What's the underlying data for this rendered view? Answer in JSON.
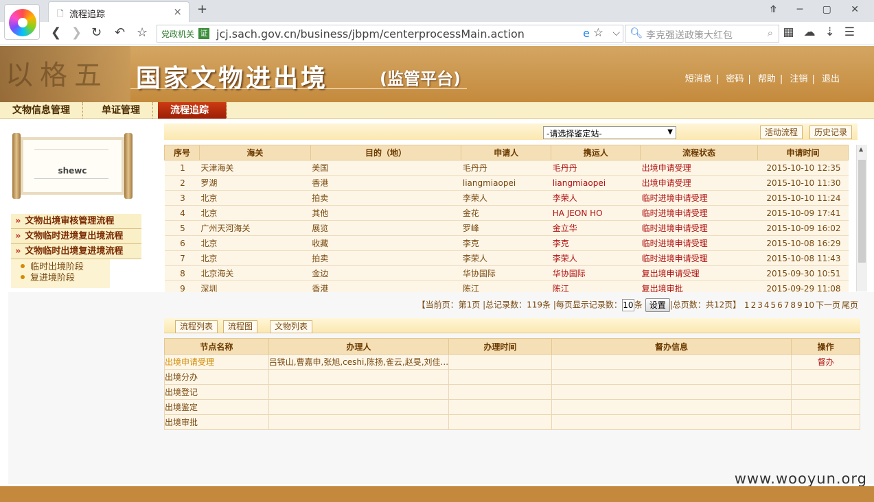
{
  "browser": {
    "tab_title": "流程追踪",
    "new_tab": "+",
    "window_controls": "⤊ ─ ▢ ✕",
    "badge": "党政机关",
    "zheng": "证",
    "url": "jcj.sach.gov.cn/business/jbpm/centerprocessMain.action",
    "search_text": "李克强送政策大红包"
  },
  "site": {
    "glyphs": "以格五",
    "title": "国家文物进出境",
    "subtitle": "(监管平台)",
    "links": [
      "短消息",
      "密码",
      "帮助",
      "注销",
      "退出"
    ]
  },
  "menu": [
    "文物信息管理",
    "单证管理",
    "流程追踪"
  ],
  "user": {
    "name": "shewc"
  },
  "left_menu": [
    "文物出境审核管理流程",
    "文物临时进境复出境流程",
    "文物临时出境复进境流程"
  ],
  "left_submenu": [
    "临时出境阶段",
    "复进境阶段"
  ],
  "station": {
    "selected": "-请选择鉴定站-"
  },
  "flow_tabs": [
    "活动流程",
    "历史记录"
  ],
  "grid": {
    "headers": [
      "序号",
      "海关",
      "目的（地）",
      "申请人",
      "携运人",
      "流程状态",
      "申请时间"
    ],
    "rows": [
      [
        "1",
        "天津海关",
        "美国",
        "毛丹丹",
        "毛丹丹",
        "出境申请受理",
        "2015-10-10 12:35"
      ],
      [
        "2",
        "罗湖",
        "香港",
        "liangmiaopei",
        "liangmiaopei",
        "出境申请受理",
        "2015-10-10 11:30"
      ],
      [
        "3",
        "北京",
        "拍卖",
        "李荣人",
        "李荣人",
        "临时进境申请受理",
        "2015-10-10 11:24"
      ],
      [
        "4",
        "北京",
        "其他",
        "金花",
        "HA JEON HO",
        "临时进境申请受理",
        "2015-10-09 17:41"
      ],
      [
        "5",
        "广州天河海关",
        "展览",
        "罗峰",
        "金立华",
        "临时进境申请受理",
        "2015-10-09 16:02"
      ],
      [
        "6",
        "北京",
        "收藏",
        "李克",
        "李克",
        "临时进境申请受理",
        "2015-10-08 16:29"
      ],
      [
        "7",
        "北京",
        "拍卖",
        "李荣人",
        "李荣人",
        "临时进境申请受理",
        "2015-10-08 11:43"
      ],
      [
        "8",
        "北京海关",
        "金边",
        "华协国际",
        "华协国际",
        "复出境申请受理",
        "2015-09-30 10:51"
      ],
      [
        "9",
        "深圳",
        "香港",
        "陈江",
        "陈江",
        "复出境审批",
        "2015-09-29 11:08"
      ]
    ]
  },
  "pager": {
    "current_label": "【当前页：",
    "current": "第1页",
    "total_label": "|总记录数：",
    "total": "119条",
    "per_page_label": "|每页显示记录数：",
    "per_page": "10",
    "per_page_unit": "条",
    "set_button": "设置",
    "pages_label": "|总页数：",
    "pages": "共12页】",
    "links": [
      "1",
      "2",
      "3",
      "4",
      "5",
      "6",
      "7",
      "8",
      "9",
      "10",
      "下一页",
      "尾页"
    ]
  },
  "detail_tabs": [
    "流程列表",
    "流程图",
    "文物列表"
  ],
  "nodes": {
    "headers": [
      "节点名称",
      "办理人",
      "办理时间",
      "督办信息",
      "操作"
    ],
    "rows": [
      [
        "出境申请受理",
        "吕铁山,曹嘉申,张旭,ceshi,陈扬,雀云,赵旻,刘佳...",
        "",
        "",
        "督办"
      ],
      [
        "出境分办",
        "",
        "",
        "",
        ""
      ],
      [
        "出境登记",
        "",
        "",
        "",
        ""
      ],
      [
        "出境鉴定",
        "",
        "",
        "",
        ""
      ],
      [
        "出境审批",
        "",
        "",
        "",
        ""
      ]
    ]
  },
  "watermark": "www.wooyun.org"
}
